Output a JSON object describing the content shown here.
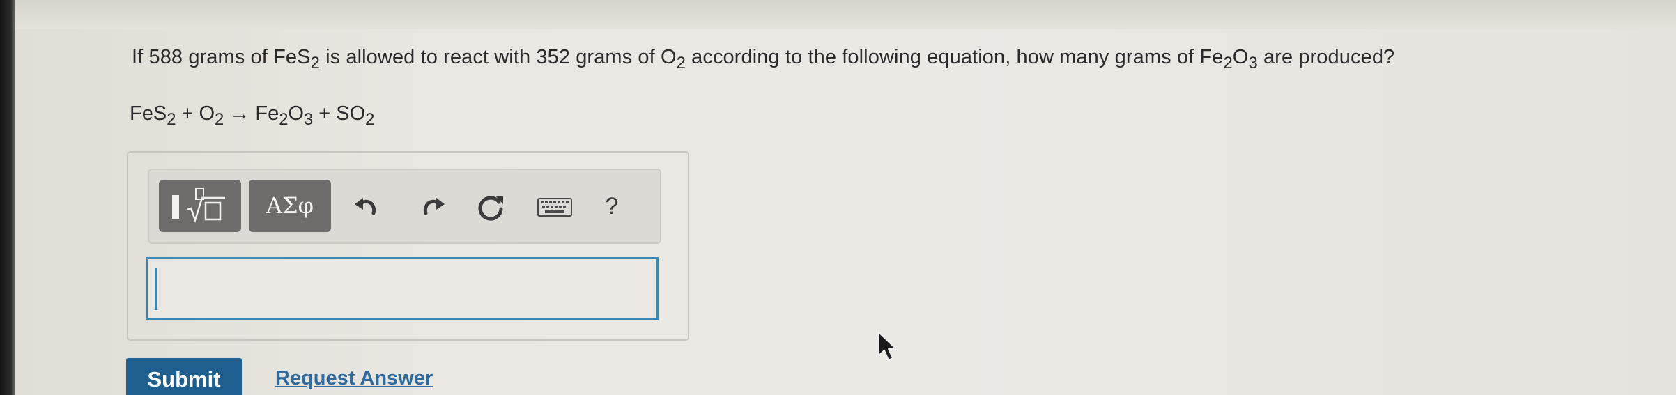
{
  "question": {
    "part1": "If 588 grams of FeS",
    "sub1": "2",
    "part2": " is allowed to react with 352 grams of O",
    "sub2": "2",
    "part3": " according to the following equation, how many grams of Fe",
    "sub3": "2",
    "part4": "O",
    "sub4": "3",
    "part5": " are produced?"
  },
  "equation": {
    "reactant1": "FeS",
    "reactant1_sub": "2",
    "plus1": " + O",
    "plus1_sub": "2",
    "arrow": " → Fe",
    "product1_sub1": "2",
    "product1_o": "O",
    "product1_sub2": "3",
    "plus2": " + SO",
    "product2_sub": "2"
  },
  "toolbar": {
    "templates_icon": "templates-sqrt-icon",
    "symbols_label": "ΑΣφ",
    "undo_icon": "undo-icon",
    "redo_icon": "redo-icon",
    "reset_icon": "reset-icon",
    "keyboard_icon": "keyboard-icon",
    "help_label": "?"
  },
  "answer": {
    "value": ""
  },
  "actions": {
    "submit_label": "Submit",
    "request_answer_label": "Request Answer"
  },
  "colors": {
    "accent_blue": "#3b87b3",
    "submit_blue": "#1f5f8f",
    "link_blue": "#2e6aa0",
    "toolbar_button_gray": "#6d6c6a"
  }
}
